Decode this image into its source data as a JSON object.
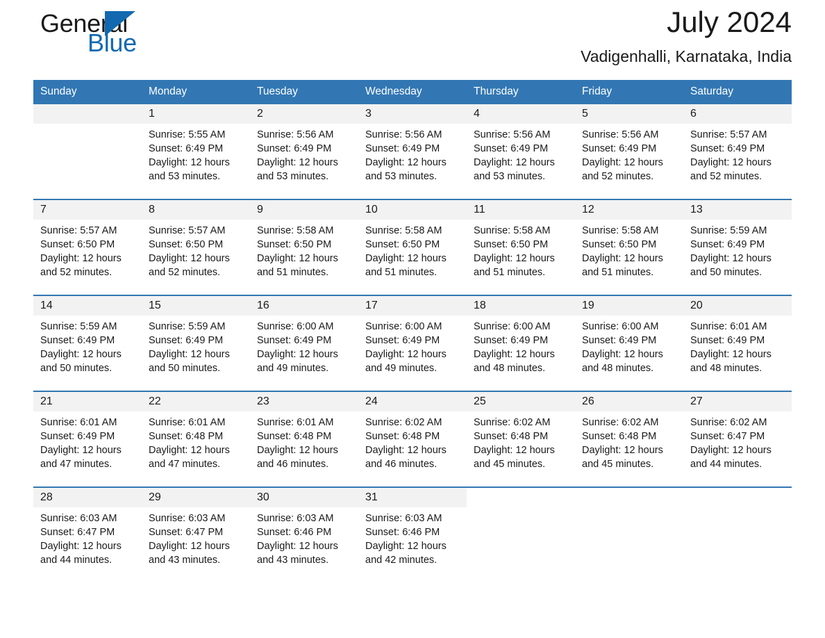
{
  "brand": {
    "word_one": "General",
    "word_two": "Blue",
    "logo_icon": "triangle-flag-icon",
    "accent_color": "#1269b0"
  },
  "header": {
    "title": "July 2024",
    "location": "Vadigenhalli, Karnataka, India"
  },
  "calendar": {
    "header_bg": "#3277b3",
    "daynum_bg": "#f2f2f2",
    "weekdays": [
      "Sunday",
      "Monday",
      "Tuesday",
      "Wednesday",
      "Thursday",
      "Friday",
      "Saturday"
    ],
    "weeks": [
      [
        {
          "day": "",
          "lines": []
        },
        {
          "day": "1",
          "lines": [
            "Sunrise: 5:55 AM",
            "Sunset: 6:49 PM",
            "Daylight: 12 hours",
            "and 53 minutes."
          ]
        },
        {
          "day": "2",
          "lines": [
            "Sunrise: 5:56 AM",
            "Sunset: 6:49 PM",
            "Daylight: 12 hours",
            "and 53 minutes."
          ]
        },
        {
          "day": "3",
          "lines": [
            "Sunrise: 5:56 AM",
            "Sunset: 6:49 PM",
            "Daylight: 12 hours",
            "and 53 minutes."
          ]
        },
        {
          "day": "4",
          "lines": [
            "Sunrise: 5:56 AM",
            "Sunset: 6:49 PM",
            "Daylight: 12 hours",
            "and 53 minutes."
          ]
        },
        {
          "day": "5",
          "lines": [
            "Sunrise: 5:56 AM",
            "Sunset: 6:49 PM",
            "Daylight: 12 hours",
            "and 52 minutes."
          ]
        },
        {
          "day": "6",
          "lines": [
            "Sunrise: 5:57 AM",
            "Sunset: 6:49 PM",
            "Daylight: 12 hours",
            "and 52 minutes."
          ]
        }
      ],
      [
        {
          "day": "7",
          "lines": [
            "Sunrise: 5:57 AM",
            "Sunset: 6:50 PM",
            "Daylight: 12 hours",
            "and 52 minutes."
          ]
        },
        {
          "day": "8",
          "lines": [
            "Sunrise: 5:57 AM",
            "Sunset: 6:50 PM",
            "Daylight: 12 hours",
            "and 52 minutes."
          ]
        },
        {
          "day": "9",
          "lines": [
            "Sunrise: 5:58 AM",
            "Sunset: 6:50 PM",
            "Daylight: 12 hours",
            "and 51 minutes."
          ]
        },
        {
          "day": "10",
          "lines": [
            "Sunrise: 5:58 AM",
            "Sunset: 6:50 PM",
            "Daylight: 12 hours",
            "and 51 minutes."
          ]
        },
        {
          "day": "11",
          "lines": [
            "Sunrise: 5:58 AM",
            "Sunset: 6:50 PM",
            "Daylight: 12 hours",
            "and 51 minutes."
          ]
        },
        {
          "day": "12",
          "lines": [
            "Sunrise: 5:58 AM",
            "Sunset: 6:50 PM",
            "Daylight: 12 hours",
            "and 51 minutes."
          ]
        },
        {
          "day": "13",
          "lines": [
            "Sunrise: 5:59 AM",
            "Sunset: 6:49 PM",
            "Daylight: 12 hours",
            "and 50 minutes."
          ]
        }
      ],
      [
        {
          "day": "14",
          "lines": [
            "Sunrise: 5:59 AM",
            "Sunset: 6:49 PM",
            "Daylight: 12 hours",
            "and 50 minutes."
          ]
        },
        {
          "day": "15",
          "lines": [
            "Sunrise: 5:59 AM",
            "Sunset: 6:49 PM",
            "Daylight: 12 hours",
            "and 50 minutes."
          ]
        },
        {
          "day": "16",
          "lines": [
            "Sunrise: 6:00 AM",
            "Sunset: 6:49 PM",
            "Daylight: 12 hours",
            "and 49 minutes."
          ]
        },
        {
          "day": "17",
          "lines": [
            "Sunrise: 6:00 AM",
            "Sunset: 6:49 PM",
            "Daylight: 12 hours",
            "and 49 minutes."
          ]
        },
        {
          "day": "18",
          "lines": [
            "Sunrise: 6:00 AM",
            "Sunset: 6:49 PM",
            "Daylight: 12 hours",
            "and 48 minutes."
          ]
        },
        {
          "day": "19",
          "lines": [
            "Sunrise: 6:00 AM",
            "Sunset: 6:49 PM",
            "Daylight: 12 hours",
            "and 48 minutes."
          ]
        },
        {
          "day": "20",
          "lines": [
            "Sunrise: 6:01 AM",
            "Sunset: 6:49 PM",
            "Daylight: 12 hours",
            "and 48 minutes."
          ]
        }
      ],
      [
        {
          "day": "21",
          "lines": [
            "Sunrise: 6:01 AM",
            "Sunset: 6:49 PM",
            "Daylight: 12 hours",
            "and 47 minutes."
          ]
        },
        {
          "day": "22",
          "lines": [
            "Sunrise: 6:01 AM",
            "Sunset: 6:48 PM",
            "Daylight: 12 hours",
            "and 47 minutes."
          ]
        },
        {
          "day": "23",
          "lines": [
            "Sunrise: 6:01 AM",
            "Sunset: 6:48 PM",
            "Daylight: 12 hours",
            "and 46 minutes."
          ]
        },
        {
          "day": "24",
          "lines": [
            "Sunrise: 6:02 AM",
            "Sunset: 6:48 PM",
            "Daylight: 12 hours",
            "and 46 minutes."
          ]
        },
        {
          "day": "25",
          "lines": [
            "Sunrise: 6:02 AM",
            "Sunset: 6:48 PM",
            "Daylight: 12 hours",
            "and 45 minutes."
          ]
        },
        {
          "day": "26",
          "lines": [
            "Sunrise: 6:02 AM",
            "Sunset: 6:48 PM",
            "Daylight: 12 hours",
            "and 45 minutes."
          ]
        },
        {
          "day": "27",
          "lines": [
            "Sunrise: 6:02 AM",
            "Sunset: 6:47 PM",
            "Daylight: 12 hours",
            "and 44 minutes."
          ]
        }
      ],
      [
        {
          "day": "28",
          "lines": [
            "Sunrise: 6:03 AM",
            "Sunset: 6:47 PM",
            "Daylight: 12 hours",
            "and 44 minutes."
          ]
        },
        {
          "day": "29",
          "lines": [
            "Sunrise: 6:03 AM",
            "Sunset: 6:47 PM",
            "Daylight: 12 hours",
            "and 43 minutes."
          ]
        },
        {
          "day": "30",
          "lines": [
            "Sunrise: 6:03 AM",
            "Sunset: 6:46 PM",
            "Daylight: 12 hours",
            "and 43 minutes."
          ]
        },
        {
          "day": "31",
          "lines": [
            "Sunrise: 6:03 AM",
            "Sunset: 6:46 PM",
            "Daylight: 12 hours",
            "and 42 minutes."
          ]
        },
        {
          "day": "",
          "lines": []
        },
        {
          "day": "",
          "lines": []
        },
        {
          "day": "",
          "lines": []
        }
      ]
    ]
  }
}
